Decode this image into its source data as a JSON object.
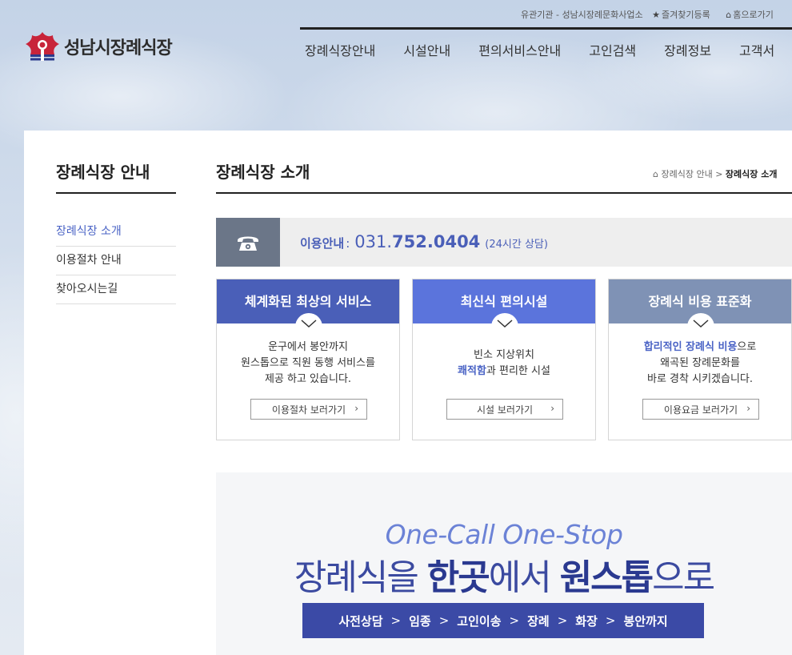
{
  "util": {
    "related": "유관기관 - 성남시장례문화사업소",
    "bookmark": "즐겨찾기등록",
    "home": "홈으로가기"
  },
  "logo": {
    "text": "성남시장례식장"
  },
  "nav": [
    "장례식장안내",
    "시설안내",
    "편의서비스안내",
    "고인검색",
    "장례정보",
    "고객서"
  ],
  "sidebar": {
    "title": "장례식장 안내",
    "items": [
      "장례식장 소개",
      "이용절차 안내",
      "찾아오시는길"
    ]
  },
  "page": {
    "title": "장례식장 소개",
    "breadcrumb_parent": "장례식장 안내",
    "breadcrumb_current": "장례식장 소개"
  },
  "phone": {
    "label": "이용안내",
    "colon": ":",
    "num_prefix": "031.",
    "num_main": "752.0404",
    "note": "(24시간 상담)"
  },
  "cards": [
    {
      "title": "체계화된 최상의 서비스",
      "color": "#4a5fb8",
      "line1": "운구에서 봉안까지",
      "line2": "원스톱으로 직원 동행 서비스를",
      "line3": "제공 하고 있습니다.",
      "button": "이용절차 보러가기"
    },
    {
      "title": "최신식 편의시설",
      "color": "#5b74dc",
      "line1": "빈소 지상위치",
      "line2_hl": "쾌적함",
      "line2_rest": "과 편리한 시설",
      "button": "시설 보러가기"
    },
    {
      "title": "장례식 비용 표준화",
      "color": "#7f92b5",
      "line1_hl": "합리적인 장례식 비용",
      "line1_rest": "으로",
      "line2": "왜곡된 장례문화를",
      "line3": "바로 경착 시키겠습니다.",
      "button": "이용요금 보러가기"
    }
  ],
  "banner": {
    "eng": "One-Call One-Stop",
    "kor_1": "장례식을 ",
    "kor_2": "한곳",
    "kor_3": "에서 ",
    "kor_4": "원스톱",
    "kor_5": "으로",
    "steps": [
      "사전상담",
      "임종",
      "고인이송",
      "장례",
      "화장",
      "봉안까지"
    ]
  },
  "colors": {
    "accent": "#4a63c5",
    "phone_box": "#6b7688",
    "banner_bar": "#3b4aa6"
  }
}
